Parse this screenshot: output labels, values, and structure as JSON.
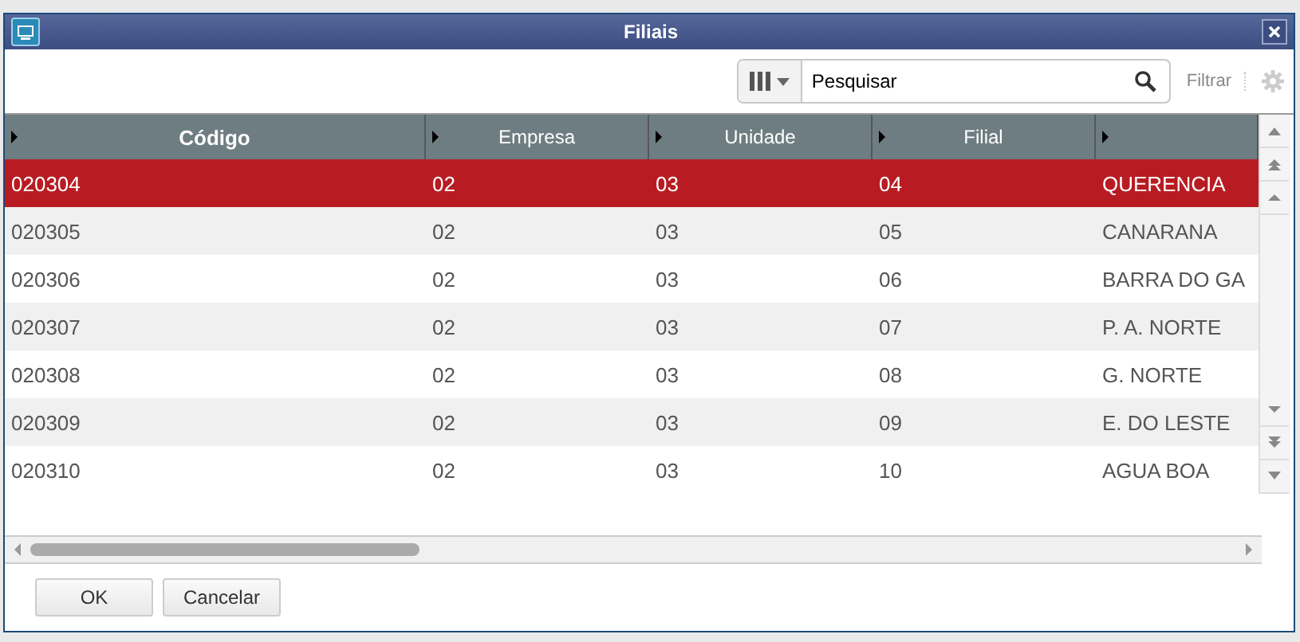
{
  "window": {
    "title": "Filiais"
  },
  "toolbar": {
    "search": {
      "placeholder": "Pesquisar"
    },
    "filter_label": "Filtrar"
  },
  "table": {
    "columns": [
      "Código",
      "Empresa",
      "Unidade",
      "Filial",
      ""
    ],
    "rows": [
      {
        "cells": [
          "020304",
          "02",
          "03",
          "04",
          "QUERENCIA"
        ],
        "selected": true
      },
      {
        "cells": [
          "020305",
          "02",
          "03",
          "05",
          "CANARANA"
        ],
        "selected": false
      },
      {
        "cells": [
          "020306",
          "02",
          "03",
          "06",
          "BARRA DO GA"
        ],
        "selected": false
      },
      {
        "cells": [
          "020307",
          "02",
          "03",
          "07",
          "P. A. NORTE"
        ],
        "selected": false
      },
      {
        "cells": [
          "020308",
          "02",
          "03",
          "08",
          "G. NORTE"
        ],
        "selected": false
      },
      {
        "cells": [
          "020309",
          "02",
          "03",
          "09",
          "E. DO LESTE"
        ],
        "selected": false
      },
      {
        "cells": [
          "020310",
          "02",
          "03",
          "10",
          "AGUA BOA"
        ],
        "selected": false
      }
    ]
  },
  "buttons": [
    "OK",
    "Cancelar"
  ]
}
